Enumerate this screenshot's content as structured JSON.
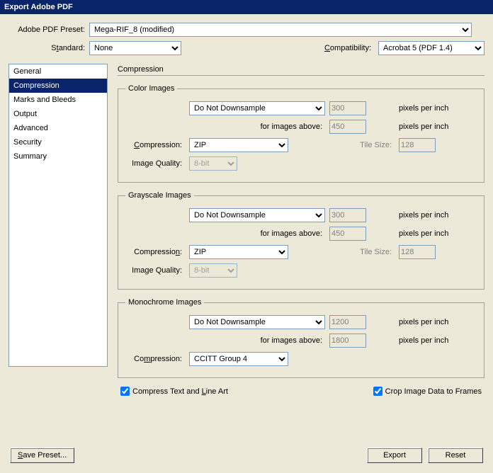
{
  "titlebar": "Export Adobe PDF",
  "labels": {
    "preset": "Adobe PDF Preset:",
    "standard_pre": "S",
    "standard_key": "t",
    "standard_post": "andard:",
    "compat_pre": "",
    "compat_key": "C",
    "compat_post": "ompatibility:"
  },
  "preset_value": "Mega-RIF_8 (modified)",
  "standard_value": "None",
  "compat_value": "Acrobat 5 (PDF 1.4)",
  "sidebar": {
    "items": [
      {
        "label": "General"
      },
      {
        "label": "Compression"
      },
      {
        "label": "Marks and Bleeds"
      },
      {
        "label": "Output"
      },
      {
        "label": "Advanced"
      },
      {
        "label": "Security"
      },
      {
        "label": "Summary"
      }
    ],
    "selected_index": 1
  },
  "content_header": "Compression",
  "color": {
    "legend": "Color Images",
    "downsample": "Do Not Downsample",
    "dpi": "300",
    "above_label": "for images above:",
    "above_dpi": "450",
    "unit": "pixels per inch",
    "comp_key": "C",
    "comp_post": "ompression:",
    "compression": "ZIP",
    "tile_label": "Tile Size:",
    "tile_value": "128",
    "quality_label": "Image Quality:",
    "quality": "8-bit"
  },
  "gray": {
    "legend": "Grayscale Images",
    "downsample": "Do Not Downsample",
    "dpi": "300",
    "above_label": "for images above:",
    "above_dpi": "450",
    "unit": "pixels per inch",
    "comp_pre": "Compressio",
    "comp_key": "n",
    "comp_post": ":",
    "compression": "ZIP",
    "tile_label": "Tile Size:",
    "tile_value": "128",
    "quality_label": "Image Quality:",
    "quality": "8-bit"
  },
  "mono": {
    "legend": "Monochrome Images",
    "downsample": "Do Not Downsample",
    "dpi": "1200",
    "above_label": "for images above:",
    "above_dpi": "1800",
    "unit": "pixels per inch",
    "comp_pre": "Co",
    "comp_key": "m",
    "comp_post": "pression:",
    "compression": "CCITT Group 4"
  },
  "checkboxes": {
    "compress_text_pre": "Compress Text and ",
    "compress_text_key": "L",
    "compress_text_post": "ine Art",
    "crop_label": "Crop Image Data to Frames"
  },
  "buttons": {
    "save_pre": "",
    "save_key": "S",
    "save_post": "ave Preset...",
    "export": "Export",
    "reset": "Reset"
  }
}
